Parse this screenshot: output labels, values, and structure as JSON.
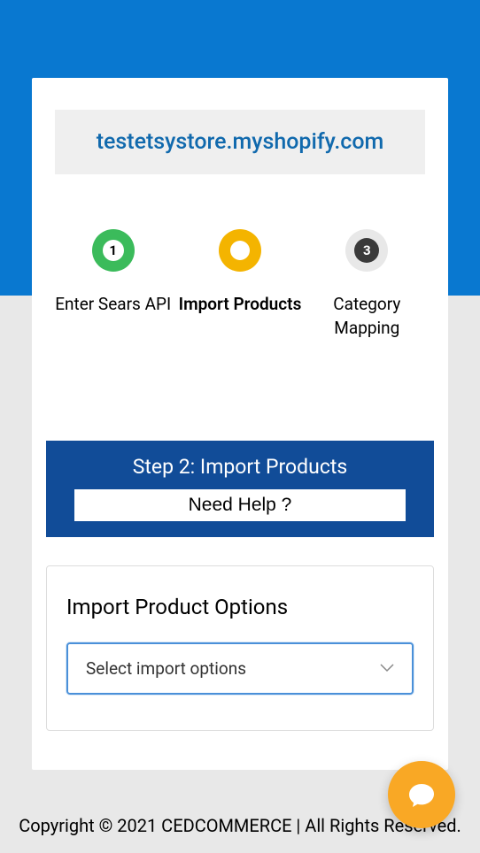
{
  "store_url": "testetsystore.myshopify.com",
  "steps": [
    {
      "number": "1",
      "label": "Enter Sears API"
    },
    {
      "number": "",
      "label": "Import Products"
    },
    {
      "number": "3",
      "label": "Category Mapping"
    }
  ],
  "banner": {
    "title": "Step 2: Import Products",
    "help_button": "Need Help ?"
  },
  "options": {
    "title": "Import Product Options",
    "select_placeholder": "Select import options"
  },
  "footer": "Copyright © 2021 CEDCOMMERCE | All Rights Reserved."
}
